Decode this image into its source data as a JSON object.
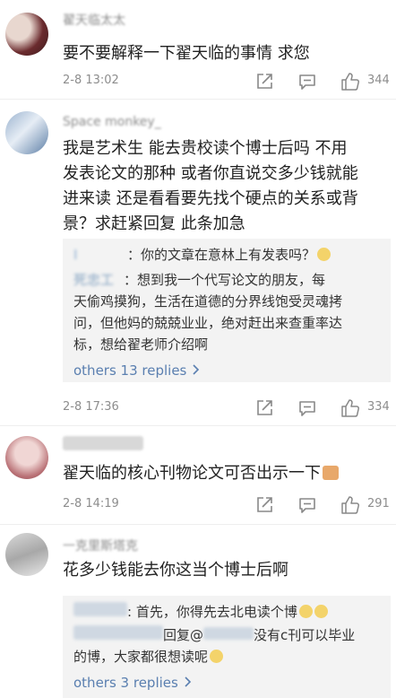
{
  "comments": [
    {
      "username": "翟天临太太",
      "text": "要不要解释一下翟天临的事情 求您",
      "date": "2-8 13:02",
      "likes": "344"
    },
    {
      "username": "Space monkey_",
      "text_lines": [
        "我是艺术生 能去贵校读个博士后吗 不用",
        "发表论文的那种 或者你直说交多少钱就能",
        "进来读 还是看看要先找个硬点的关系或背",
        "景？求赶紧回复 此条加急"
      ],
      "replies": [
        {
          "name": "Ⅰ",
          "text": "你的文章在意林上有发表吗？"
        },
        {
          "name": "死忠工",
          "text_lines": [
            "想到我一个代写论文的朋友，每",
            "天偷鸡摸狗，生活在道德的分界线饱受灵魂拷",
            "问，但他妈的兢兢业业，绝对赶出来查重率达",
            "标，想给翟老师介绍啊"
          ]
        }
      ],
      "more_replies": "others 13 replies",
      "date": "2-8 17:36",
      "likes": "334"
    },
    {
      "username": "",
      "text": "翟天临的核心刊物论文可否出示一下",
      "date": "2-8 14:19",
      "likes": "291"
    },
    {
      "username": "一克里斯塔克",
      "text": "花多少钱能去你这当个博士后啊",
      "replies": [
        {
          "name": "",
          "text": "首先，你得先去北电读个博"
        },
        {
          "name": "",
          "text_lines": [
            "回复@",
            "没有c刊可以毕业",
            "的博，大家都很想读呢"
          ]
        }
      ],
      "more_replies": "others 3 replies"
    }
  ],
  "colors": {
    "link": "#5a7fb0",
    "meta": "#8d8d8d",
    "reply_bg": "#f3f3f3"
  },
  "icons": [
    "share-icon",
    "comment-icon",
    "like-icon"
  ]
}
